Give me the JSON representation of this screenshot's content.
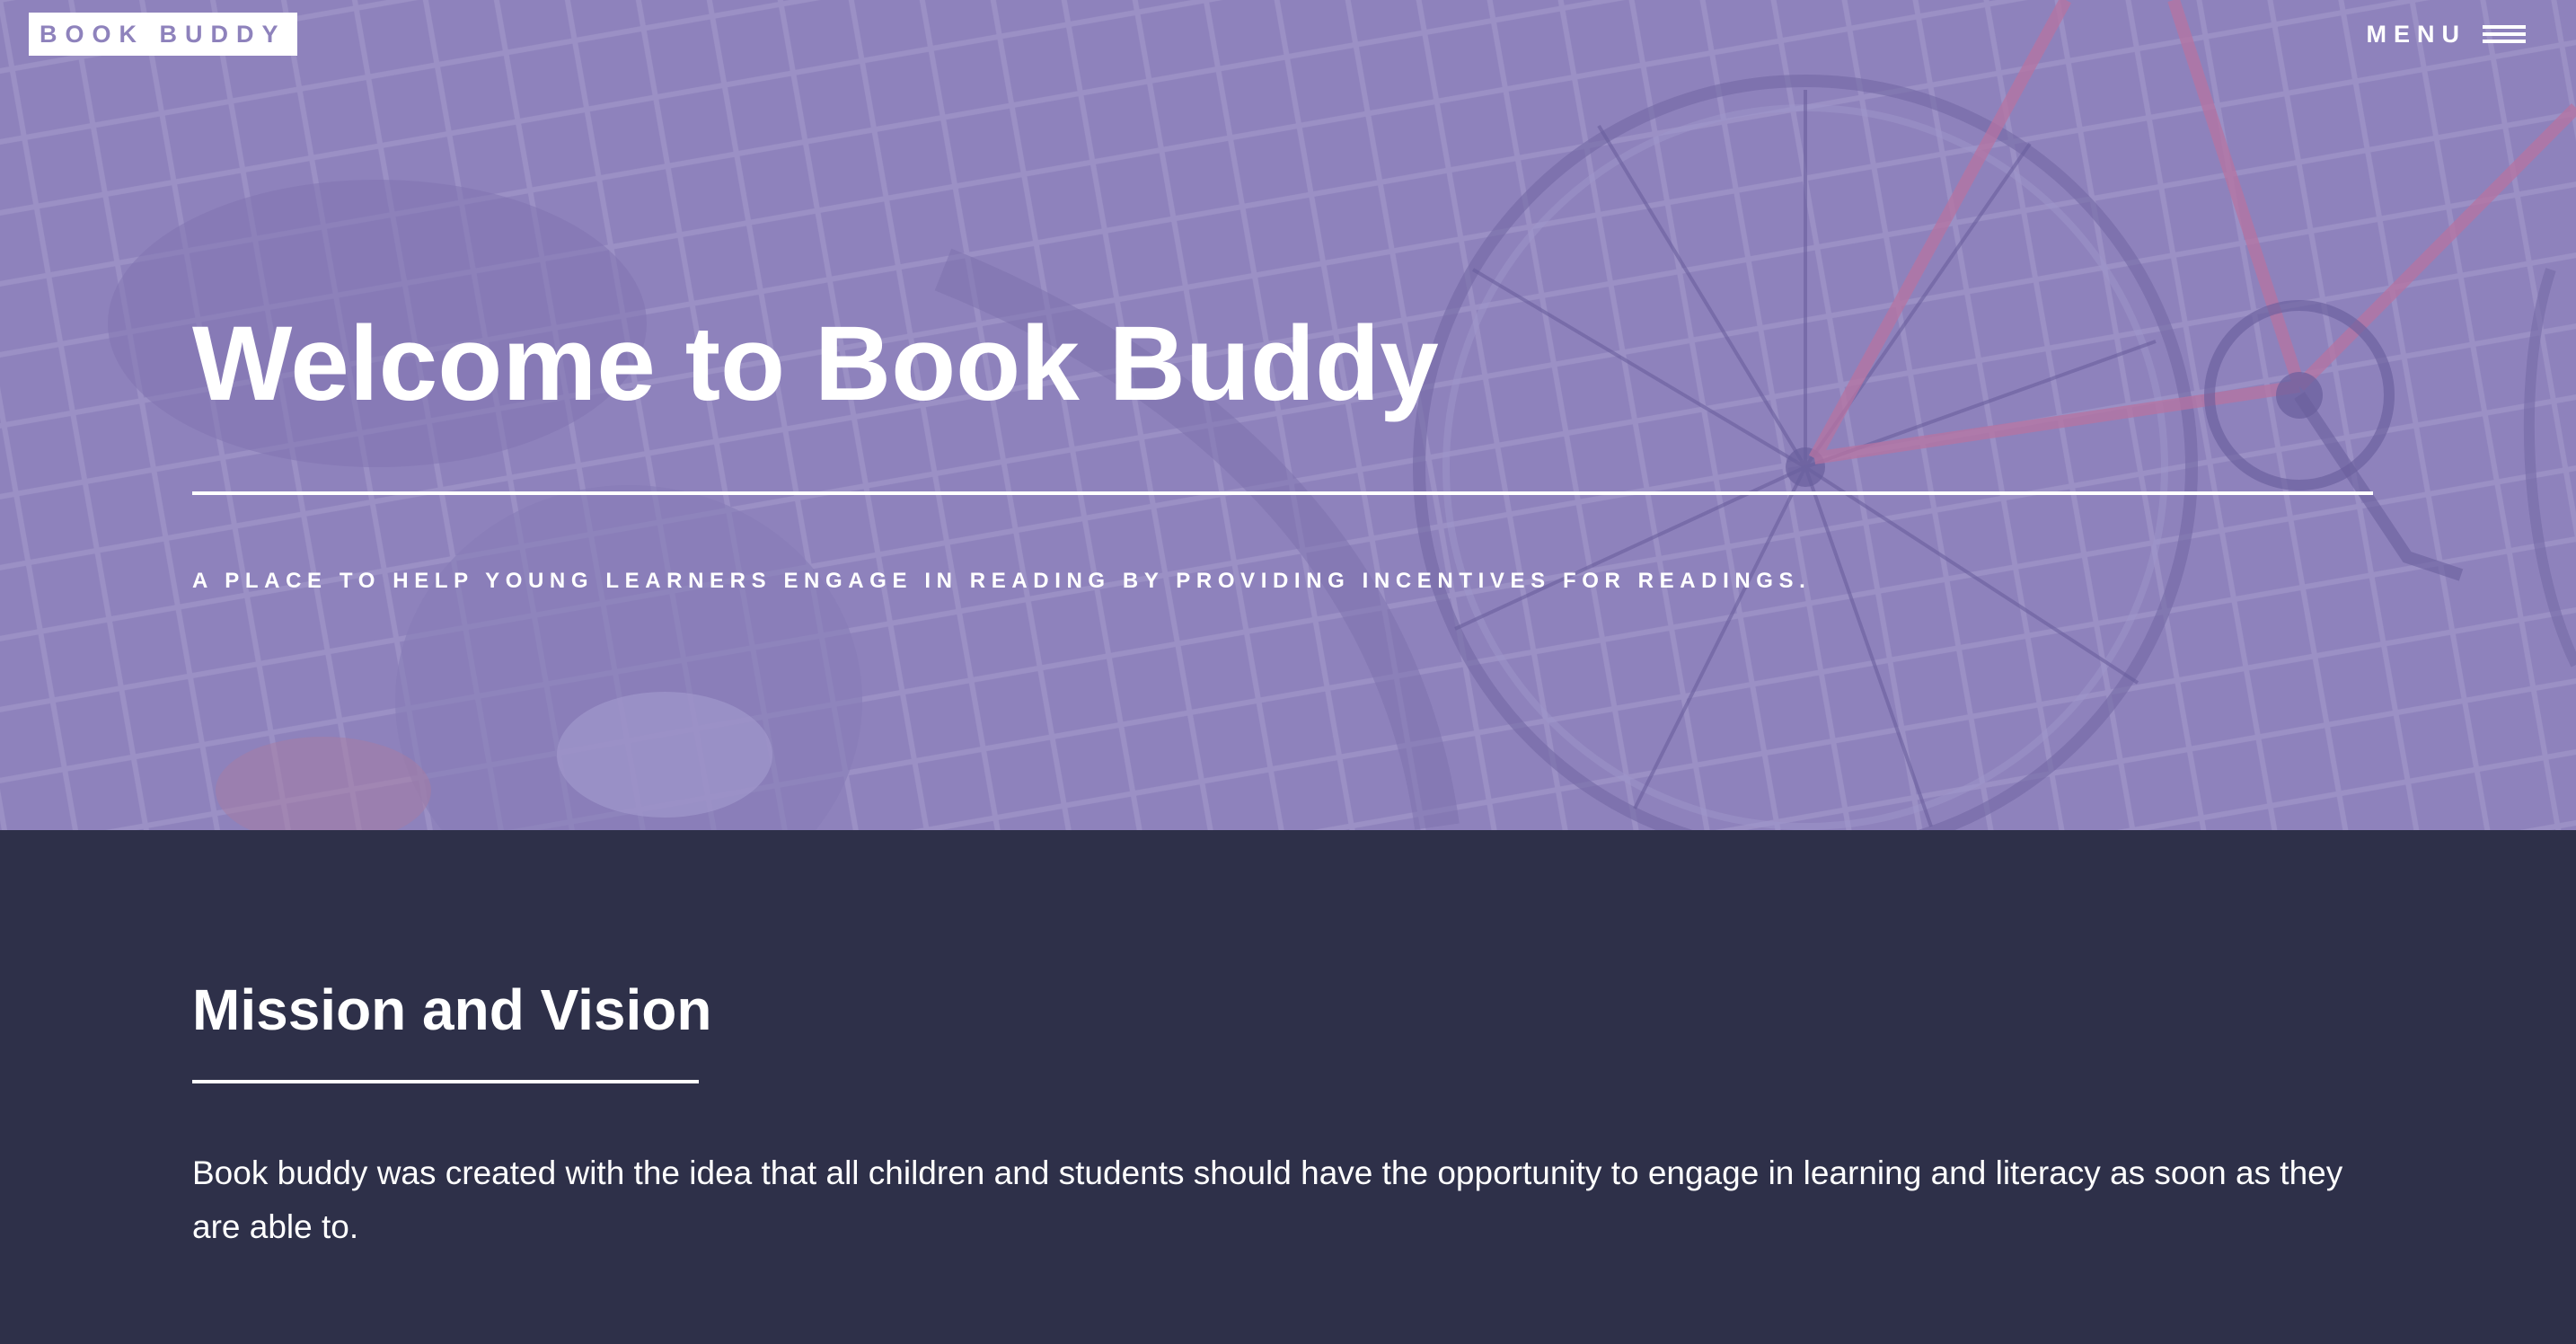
{
  "header": {
    "logo_text": "BOOK BUDDY",
    "menu_label": "MENU",
    "menu_icon": "hamburger-icon"
  },
  "hero": {
    "title": "Welcome to Book Buddy",
    "subtitle": "A PLACE TO HELP YOUNG LEARNERS ENGAGE IN READING BY PROVIDING INCENTIVES FOR READINGS."
  },
  "mission": {
    "title": "Mission and Vision",
    "text": "Book buddy was created with the idea that all children and students should have the opportunity to engage in learning and literacy as soon as they are able to."
  },
  "colors": {
    "hero_overlay": "#8e82bc",
    "content_background": "#2e3049",
    "text": "#ffffff"
  }
}
